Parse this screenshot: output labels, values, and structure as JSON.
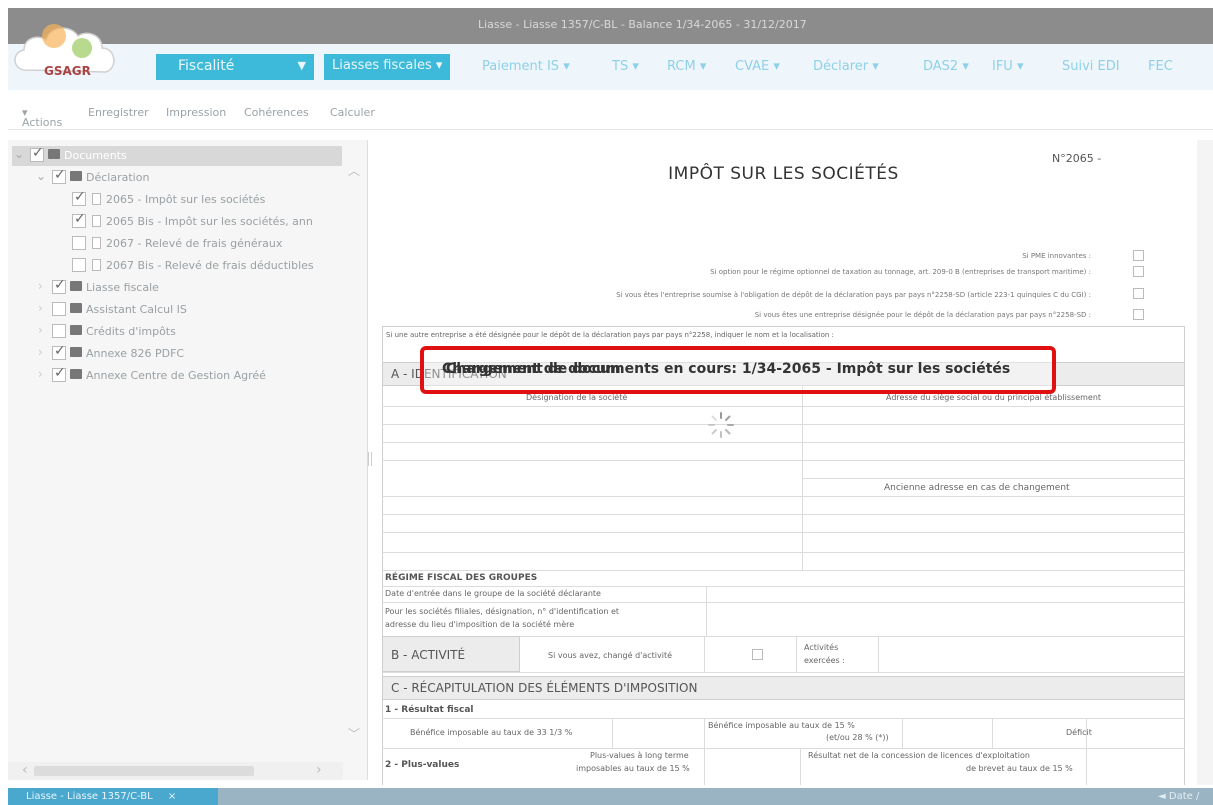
{
  "window": {
    "title": "Liasse - Liasse 1357/C-BL - Balance 1/34-2065 - 31/12/2017"
  },
  "logo": {
    "text": "GSAGR"
  },
  "nav": {
    "fiscalite": "Fiscalité",
    "items": [
      "Liasses fiscales",
      "Paiement IS",
      "TS",
      "RCM",
      "CVAE",
      "Déclarer",
      "DAS2",
      "IFU",
      "Suivi EDI",
      "FEC"
    ]
  },
  "toolbar": [
    "Actions",
    "Enregistrer",
    "Impression",
    "Cohérences",
    "Calculer"
  ],
  "tree": {
    "rows": [
      {
        "label": "Documents",
        "level": 0,
        "checked": true,
        "type": "folder"
      },
      {
        "label": "Déclaration",
        "level": 1,
        "checked": true,
        "type": "folder"
      },
      {
        "label": "2065 - Impôt sur les sociétés",
        "level": 2,
        "checked": true,
        "type": "doc"
      },
      {
        "label": "2065 Bis - Impôt sur les sociétés, ann",
        "level": 2,
        "checked": true,
        "type": "doc"
      },
      {
        "label": "2067 - Relevé de frais généraux",
        "level": 2,
        "checked": false,
        "type": "doc"
      },
      {
        "label": "2067 Bis - Relevé de frais déductibles",
        "level": 2,
        "checked": false,
        "type": "doc"
      },
      {
        "label": "Liasse fiscale",
        "level": 1,
        "checked": true,
        "type": "folder"
      },
      {
        "label": "Assistant Calcul IS",
        "level": 1,
        "checked": false,
        "type": "folder"
      },
      {
        "label": "Crédits d'impôts",
        "level": 1,
        "checked": false,
        "type": "folder"
      },
      {
        "label": "Annexe 826 PDFC",
        "level": 1,
        "checked": true,
        "type": "folder"
      },
      {
        "label": "Annexe Centre de Gestion Agréé",
        "level": 1,
        "checked": true,
        "type": "folder"
      }
    ]
  },
  "doc": {
    "form_number": "N°2065 -",
    "title": "IMPÔT SUR LES SOCIÉTÉS",
    "checkbox_lines": [
      "Si PME innovantes :",
      "Si option pour le régime optionnel de taxation au tonnage, art. 209-0 B (entreprises de transport maritime) :",
      "Si vous êtes l'entreprise soumise à l'obligation de dépôt de la déclaration pays par pays n°2258-SD (article 223-1 quinquies C du CGI) :",
      "Si vous êtes une entreprise désignée pour le dépôt de la déclaration pays par pays n°2258-SD :"
    ],
    "other_entity_line": "Si une autre entreprise a été désignée pour le dépôt de la déclaration pays par pays n°2258, indiquer le nom et la localisation :",
    "section_a": "A - IDENTIFICATION",
    "col_designation": "Désignation de la société",
    "col_address": "Adresse du siège social ou du principal établissement",
    "old_address": "Ancienne adresse en cas de changement",
    "regime_title": "RÉGIME FISCAL DES GROUPES",
    "regime_line1": "Date d'entrée dans le groupe de la société déclarante",
    "regime_line2a": "Pour les sociétés filiales, désignation, n° d'identification et",
    "regime_line2b": "adresse du lieu d'imposition de la société mère",
    "section_b": "B - ACTIVITÉ",
    "b_changed": "Si vous avez, changé d'activité",
    "b_activities_a": "Activités",
    "b_activities_b": "exercées :",
    "section_c": "C - RÉCAPITULATION DES ÉLÉMENTS D'IMPOSITION",
    "c1": "1 - Résultat fiscal",
    "c1_benef_333": "Bénéfice imposable au taux de 33 1/3 %",
    "c1_benef_15a": "Bénéfice imposable au taux de 15 %",
    "c1_benef_15b": "(et/ou 28 % (*))",
    "c1_deficit": "Déficit",
    "c2": "2 - Plus-values",
    "c2_pv_a": "Plus-values à long terme",
    "c2_pv_b": "imposables au taux de 15 %",
    "c2_res_a": "Résultat net de la concession de licences d'exploitation",
    "c2_res_b": "de brevet au taux de 15 %"
  },
  "loading": {
    "message": "Chargement de documents en cours: 1/34-2065 - Impôt sur les sociétés",
    "overlay": "Chargement de docum"
  },
  "bottom": {
    "tab": "Liasse - Liasse 1357/C-BL",
    "right": "◄ Date /"
  }
}
